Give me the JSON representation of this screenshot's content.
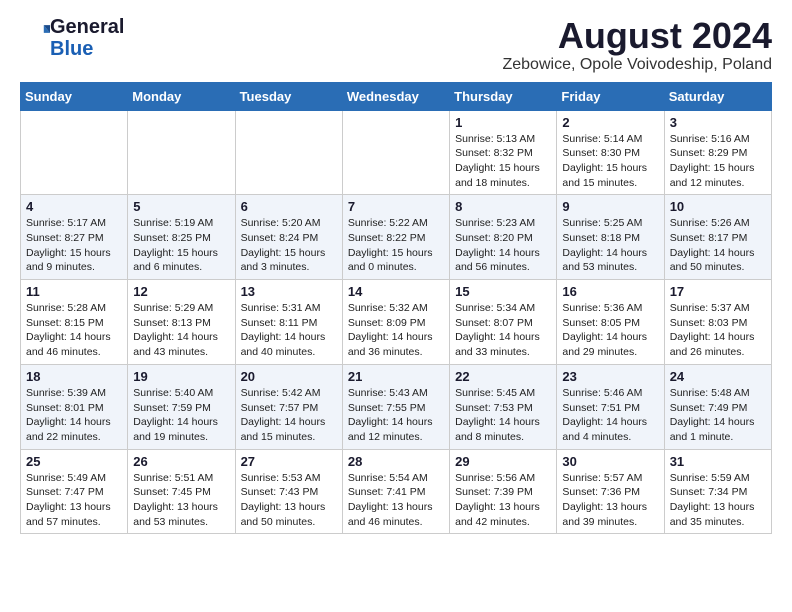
{
  "header": {
    "logo_line1": "General",
    "logo_line2": "Blue",
    "title": "August 2024",
    "subtitle": "Zebowice, Opole Voivodeship, Poland"
  },
  "days_of_week": [
    "Sunday",
    "Monday",
    "Tuesday",
    "Wednesday",
    "Thursday",
    "Friday",
    "Saturday"
  ],
  "weeks": [
    [
      {
        "num": "",
        "info": ""
      },
      {
        "num": "",
        "info": ""
      },
      {
        "num": "",
        "info": ""
      },
      {
        "num": "",
        "info": ""
      },
      {
        "num": "1",
        "info": "Sunrise: 5:13 AM\nSunset: 8:32 PM\nDaylight: 15 hours\nand 18 minutes."
      },
      {
        "num": "2",
        "info": "Sunrise: 5:14 AM\nSunset: 8:30 PM\nDaylight: 15 hours\nand 15 minutes."
      },
      {
        "num": "3",
        "info": "Sunrise: 5:16 AM\nSunset: 8:29 PM\nDaylight: 15 hours\nand 12 minutes."
      }
    ],
    [
      {
        "num": "4",
        "info": "Sunrise: 5:17 AM\nSunset: 8:27 PM\nDaylight: 15 hours\nand 9 minutes."
      },
      {
        "num": "5",
        "info": "Sunrise: 5:19 AM\nSunset: 8:25 PM\nDaylight: 15 hours\nand 6 minutes."
      },
      {
        "num": "6",
        "info": "Sunrise: 5:20 AM\nSunset: 8:24 PM\nDaylight: 15 hours\nand 3 minutes."
      },
      {
        "num": "7",
        "info": "Sunrise: 5:22 AM\nSunset: 8:22 PM\nDaylight: 15 hours\nand 0 minutes."
      },
      {
        "num": "8",
        "info": "Sunrise: 5:23 AM\nSunset: 8:20 PM\nDaylight: 14 hours\nand 56 minutes."
      },
      {
        "num": "9",
        "info": "Sunrise: 5:25 AM\nSunset: 8:18 PM\nDaylight: 14 hours\nand 53 minutes."
      },
      {
        "num": "10",
        "info": "Sunrise: 5:26 AM\nSunset: 8:17 PM\nDaylight: 14 hours\nand 50 minutes."
      }
    ],
    [
      {
        "num": "11",
        "info": "Sunrise: 5:28 AM\nSunset: 8:15 PM\nDaylight: 14 hours\nand 46 minutes."
      },
      {
        "num": "12",
        "info": "Sunrise: 5:29 AM\nSunset: 8:13 PM\nDaylight: 14 hours\nand 43 minutes."
      },
      {
        "num": "13",
        "info": "Sunrise: 5:31 AM\nSunset: 8:11 PM\nDaylight: 14 hours\nand 40 minutes."
      },
      {
        "num": "14",
        "info": "Sunrise: 5:32 AM\nSunset: 8:09 PM\nDaylight: 14 hours\nand 36 minutes."
      },
      {
        "num": "15",
        "info": "Sunrise: 5:34 AM\nSunset: 8:07 PM\nDaylight: 14 hours\nand 33 minutes."
      },
      {
        "num": "16",
        "info": "Sunrise: 5:36 AM\nSunset: 8:05 PM\nDaylight: 14 hours\nand 29 minutes."
      },
      {
        "num": "17",
        "info": "Sunrise: 5:37 AM\nSunset: 8:03 PM\nDaylight: 14 hours\nand 26 minutes."
      }
    ],
    [
      {
        "num": "18",
        "info": "Sunrise: 5:39 AM\nSunset: 8:01 PM\nDaylight: 14 hours\nand 22 minutes."
      },
      {
        "num": "19",
        "info": "Sunrise: 5:40 AM\nSunset: 7:59 PM\nDaylight: 14 hours\nand 19 minutes."
      },
      {
        "num": "20",
        "info": "Sunrise: 5:42 AM\nSunset: 7:57 PM\nDaylight: 14 hours\nand 15 minutes."
      },
      {
        "num": "21",
        "info": "Sunrise: 5:43 AM\nSunset: 7:55 PM\nDaylight: 14 hours\nand 12 minutes."
      },
      {
        "num": "22",
        "info": "Sunrise: 5:45 AM\nSunset: 7:53 PM\nDaylight: 14 hours\nand 8 minutes."
      },
      {
        "num": "23",
        "info": "Sunrise: 5:46 AM\nSunset: 7:51 PM\nDaylight: 14 hours\nand 4 minutes."
      },
      {
        "num": "24",
        "info": "Sunrise: 5:48 AM\nSunset: 7:49 PM\nDaylight: 14 hours\nand 1 minute."
      }
    ],
    [
      {
        "num": "25",
        "info": "Sunrise: 5:49 AM\nSunset: 7:47 PM\nDaylight: 13 hours\nand 57 minutes."
      },
      {
        "num": "26",
        "info": "Sunrise: 5:51 AM\nSunset: 7:45 PM\nDaylight: 13 hours\nand 53 minutes."
      },
      {
        "num": "27",
        "info": "Sunrise: 5:53 AM\nSunset: 7:43 PM\nDaylight: 13 hours\nand 50 minutes."
      },
      {
        "num": "28",
        "info": "Sunrise: 5:54 AM\nSunset: 7:41 PM\nDaylight: 13 hours\nand 46 minutes."
      },
      {
        "num": "29",
        "info": "Sunrise: 5:56 AM\nSunset: 7:39 PM\nDaylight: 13 hours\nand 42 minutes."
      },
      {
        "num": "30",
        "info": "Sunrise: 5:57 AM\nSunset: 7:36 PM\nDaylight: 13 hours\nand 39 minutes."
      },
      {
        "num": "31",
        "info": "Sunrise: 5:59 AM\nSunset: 7:34 PM\nDaylight: 13 hours\nand 35 minutes."
      }
    ]
  ]
}
